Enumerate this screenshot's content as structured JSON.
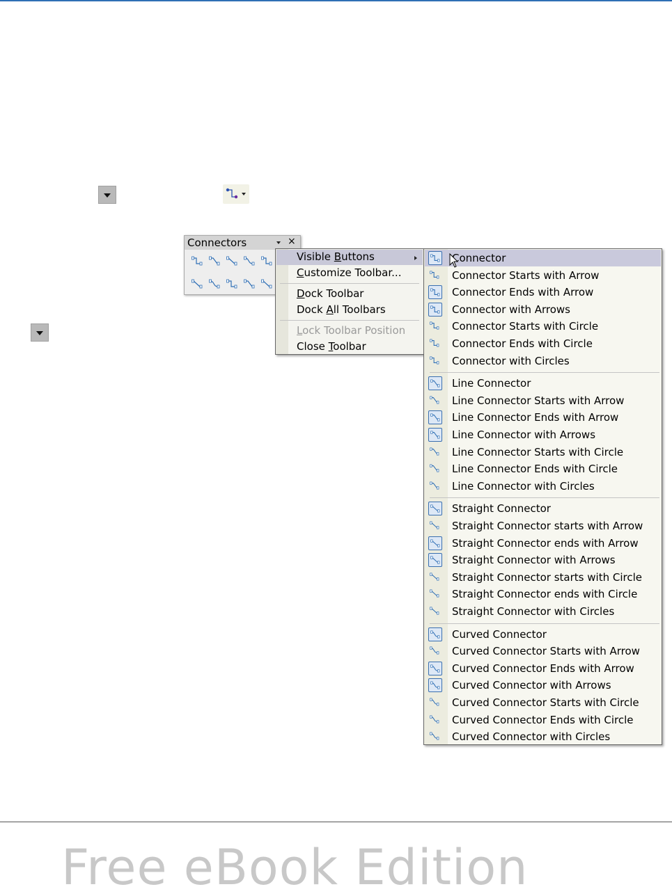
{
  "toolbar": {
    "title": "Connectors",
    "close_glyph": "×",
    "icons": [
      "connector-icon",
      "connector-starts-arrow-icon",
      "connector-arrows-icon",
      "connector-ends-arrow-icon",
      "connector-circle-icon",
      "line-connector-icon",
      "straight-connector-icon",
      "straight-arrows-icon",
      "curved-connector-icon",
      "curved-arrow-icon"
    ]
  },
  "context_menu": {
    "items": [
      {
        "label": "Visible Buttons",
        "highlighted": true,
        "has_submenu": true
      },
      {
        "label": "Customize Toolbar..."
      },
      {
        "label": "Dock Toolbar"
      },
      {
        "label": "Dock All Toolbars"
      },
      {
        "label": "Lock Toolbar Position",
        "disabled": true
      },
      {
        "label": "Close Toolbar"
      }
    ]
  },
  "submenu": {
    "groups": [
      [
        {
          "label": "Connector",
          "checked": true
        },
        {
          "label": "Connector Starts with Arrow",
          "checked": false
        },
        {
          "label": "Connector Ends with Arrow",
          "checked": true
        },
        {
          "label": "Connector with Arrows",
          "checked": true
        },
        {
          "label": "Connector Starts with Circle",
          "checked": false
        },
        {
          "label": "Connector Ends with Circle",
          "checked": false
        },
        {
          "label": "Connector with Circles",
          "checked": false
        }
      ],
      [
        {
          "label": "Line Connector",
          "checked": true
        },
        {
          "label": "Line Connector Starts with Arrow",
          "checked": false
        },
        {
          "label": "Line Connector Ends with Arrow",
          "checked": true
        },
        {
          "label": "Line Connector with Arrows",
          "checked": true
        },
        {
          "label": "Line Connector Starts with Circle",
          "checked": false
        },
        {
          "label": "Line Connector Ends with Circle",
          "checked": false
        },
        {
          "label": "Line Connector with Circles",
          "checked": false
        }
      ],
      [
        {
          "label": "Straight Connector",
          "checked": true
        },
        {
          "label": "Straight Connector starts with Arrow",
          "checked": false
        },
        {
          "label": "Straight Connector ends with Arrow",
          "checked": true
        },
        {
          "label": "Straight Connector with Arrows",
          "checked": true
        },
        {
          "label": "Straight Connector starts with Circle",
          "checked": false
        },
        {
          "label": "Straight Connector ends with Circle",
          "checked": false
        },
        {
          "label": "Straight Connector with Circles",
          "checked": false
        }
      ],
      [
        {
          "label": "Curved Connector",
          "checked": true
        },
        {
          "label": "Curved Connector Starts with Arrow",
          "checked": false
        },
        {
          "label": "Curved Connector Ends with Arrow",
          "checked": true
        },
        {
          "label": "Curved Connector with Arrows",
          "checked": true
        },
        {
          "label": "Curved Connector Starts with Circle",
          "checked": false
        },
        {
          "label": "Curved Connector Ends with Circle",
          "checked": false
        },
        {
          "label": "Curved Connector with Circles",
          "checked": false
        }
      ]
    ]
  },
  "watermark": "Free eBook Edition",
  "colors": {
    "accent": "#2f6fb5",
    "highlight": "#c9c9dc",
    "icon_blue": "#3a6fb0"
  }
}
